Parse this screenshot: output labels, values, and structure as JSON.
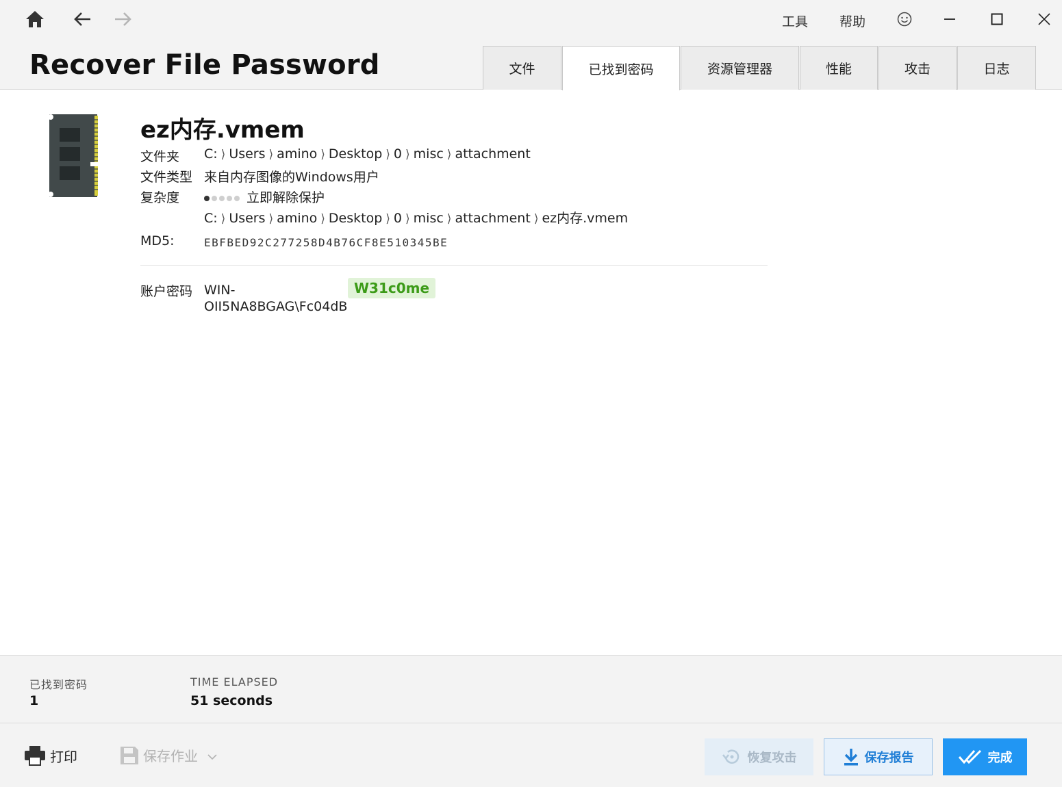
{
  "window": {
    "menu": [
      "工具",
      "帮助"
    ]
  },
  "header": {
    "title": "Recover File Password",
    "tabs": [
      {
        "label": "文件",
        "active": false
      },
      {
        "label": "已找到密码",
        "active": true
      },
      {
        "label": "资源管理器",
        "active": false
      },
      {
        "label": "性能",
        "active": false
      },
      {
        "label": "攻击",
        "active": false
      },
      {
        "label": "日志",
        "active": false
      }
    ]
  },
  "file": {
    "name": "ez内存.vmem",
    "folder_label": "文件夹",
    "folder_path": [
      "C:",
      "Users",
      "amino",
      "Desktop",
      "0",
      "misc",
      "attachment"
    ],
    "type_label": "文件类型",
    "type_value": "来自内存图像的Windows用户",
    "complexity_label": "复杂度",
    "complexity_level": 1,
    "complexity_max": 5,
    "complexity_text": "立即解除保护",
    "full_path": [
      "C:",
      "Users",
      "amino",
      "Desktop",
      "0",
      "misc",
      "attachment",
      "ez内存.vmem"
    ],
    "md5_label": "MD5:",
    "md5_value": "EBFBED92C277258D4B76CF8E510345BE"
  },
  "result": {
    "label": "账户密码",
    "account": "WIN-OII5NA8BGAG\\Fc04dB",
    "password": "W31c0me"
  },
  "stats": {
    "found_label": "已找到密码",
    "found_value": "1",
    "elapsed_label": "TIME ELAPSED",
    "elapsed_value": "51 seconds"
  },
  "footer": {
    "print_label": "打印",
    "save_job_label": "保存作业",
    "resume_label": "恢复攻击",
    "save_report_label": "保存报告",
    "done_label": "完成"
  },
  "colors": {
    "accent": "#2196f3",
    "password_text": "#3c9b18",
    "password_bg": "#e1f3d8"
  }
}
